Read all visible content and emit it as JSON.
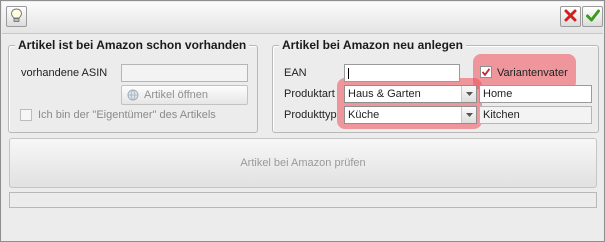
{
  "toolbar": {
    "hint_icon": "lightbulb-icon",
    "close_icon": "red-x-icon",
    "confirm_icon": "green-check-icon"
  },
  "existing_group": {
    "title": "Artikel ist bei Amazon schon vorhanden",
    "asin_label": "vorhandene ASIN",
    "asin_value": "",
    "open_button_label": "Artikel öffnen",
    "owner_checkbox_label": "Ich bin der \"Eigentümer\" des Artikels",
    "owner_checked": false
  },
  "new_group": {
    "title": "Artikel bei Amazon neu anlegen",
    "ean_label": "EAN",
    "ean_value": "",
    "variant_label": "Variantenvater",
    "variant_checked": true,
    "produktart_label": "Produktart",
    "produktart_value": "Haus & Garten",
    "produktart_mapped": "Home",
    "produkttyp_label": "Produkttyp",
    "produkttyp_value": "Küche",
    "produkttyp_mapped": "Kitchen"
  },
  "check_button_label": "Artikel bei Amazon prüfen",
  "status_text": "",
  "colors": {
    "highlight": "#f0505a",
    "checkmark": "#c0282d"
  }
}
